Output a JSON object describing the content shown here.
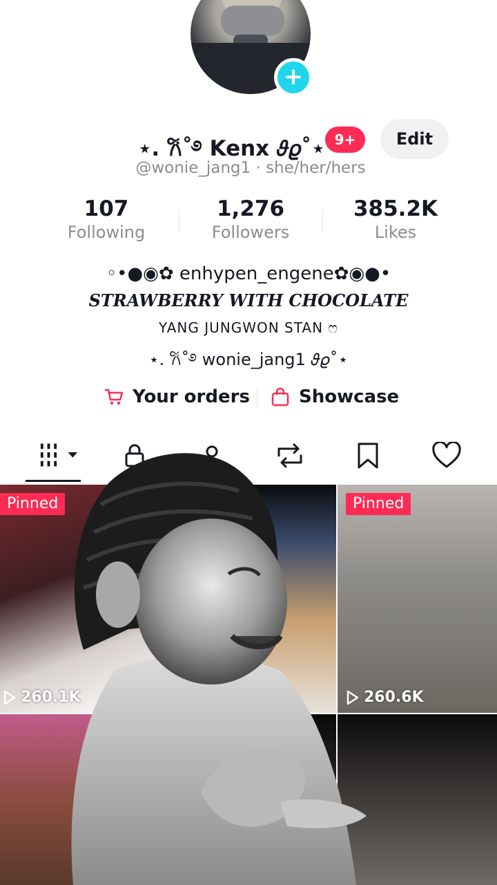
{
  "profile": {
    "display_name": "⋆. 𐙚˚࿔ Kenx 𝜗𝜚˚⋆",
    "notification_badge": "9+",
    "edit_label": "Edit",
    "handle_line": "@wonie_jang1 · she/her/hers"
  },
  "stats": [
    {
      "value": "107",
      "label": "Following"
    },
    {
      "value": "1,276",
      "label": "Followers"
    },
    {
      "value": "385.2K",
      "label": "Likes"
    }
  ],
  "bio": {
    "line1": "◦•●◉✿ enhypen_engene✿◉●•",
    "line2": "STRAWBERRY WITH CHOCOLATE",
    "line3": "YANG JUNGWON STAN ෆ",
    "line4": "⋆. 𐙚˚࿔ wonie_jang1 𝜗𝜚˚⋆"
  },
  "links": {
    "orders_label": "Your orders",
    "showcase_label": "Showcase"
  },
  "tabs": [
    "grid-icon",
    "lock-icon",
    "tagged-icon",
    "repost-icon",
    "bookmark-icon",
    "heart-icon"
  ],
  "videos": [
    {
      "pinned": "Pinned",
      "views": "260.1K"
    },
    {
      "pinned": "",
      "views": ""
    },
    {
      "pinned": "Pinned",
      "views": "260.6K"
    },
    {
      "pinned": "",
      "views": ""
    },
    {
      "pinned": "",
      "views": ""
    },
    {
      "pinned": "",
      "views": ""
    }
  ],
  "colors": {
    "accent": "#fe2c55",
    "follow_plus": "#20d5ec",
    "secondary_text": "#8a8b91"
  }
}
